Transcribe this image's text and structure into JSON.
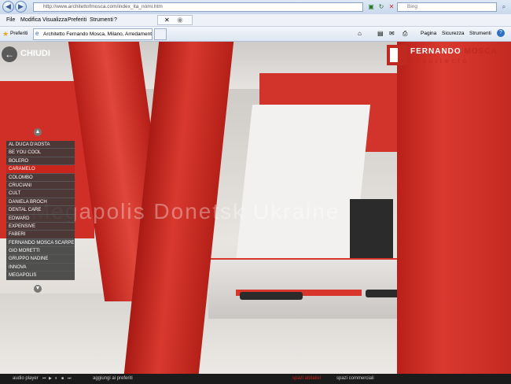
{
  "browser": {
    "address": "http://www.architettofmosca.com/index_ita_nomi.htm",
    "search_placeholder": "Bing",
    "tab_title": "Architetto Fernando Mosca, Milano, Arredamento Int...",
    "favorites_label": "Preferiti",
    "menu": [
      "File",
      "Modifica",
      "Visualizza",
      "Preferiti",
      "Strumenti",
      "?"
    ],
    "commands": [
      "Pagina",
      "Sicurezza",
      "Strumenti"
    ]
  },
  "site": {
    "close_label": "CHIUDI",
    "logo_name_a": "FERNANDO",
    "logo_name_b": "MOSCA",
    "logo_sub": "arquitecto",
    "watermark": "Megapolis Donetsk Ukraine",
    "list": [
      "AL DUCA D'AOSTA",
      "BE YOU COOL",
      "BOLERO",
      "CARAMELO",
      "COLOMBO",
      "CRUCIANI",
      "CULT",
      "DANIELA BROCH",
      "DENTAL CARE",
      "EDWARD",
      "EXPENSIVE",
      "FABERI",
      "FERNANDO MOSCA SCARPE",
      "GIO MORETTI",
      "GRUPPO NADINE",
      "INNOVA",
      "MEGAPOLIS"
    ],
    "selected_index": 3,
    "colors": {
      "accent": "#c9251c",
      "list_bg": "#3a3a3a"
    }
  },
  "footer": {
    "audio_label": "audio player",
    "favorites_label": "aggiungi ai preferiti",
    "links": [
      "spazi abitativi",
      "spazi commerciali"
    ]
  }
}
